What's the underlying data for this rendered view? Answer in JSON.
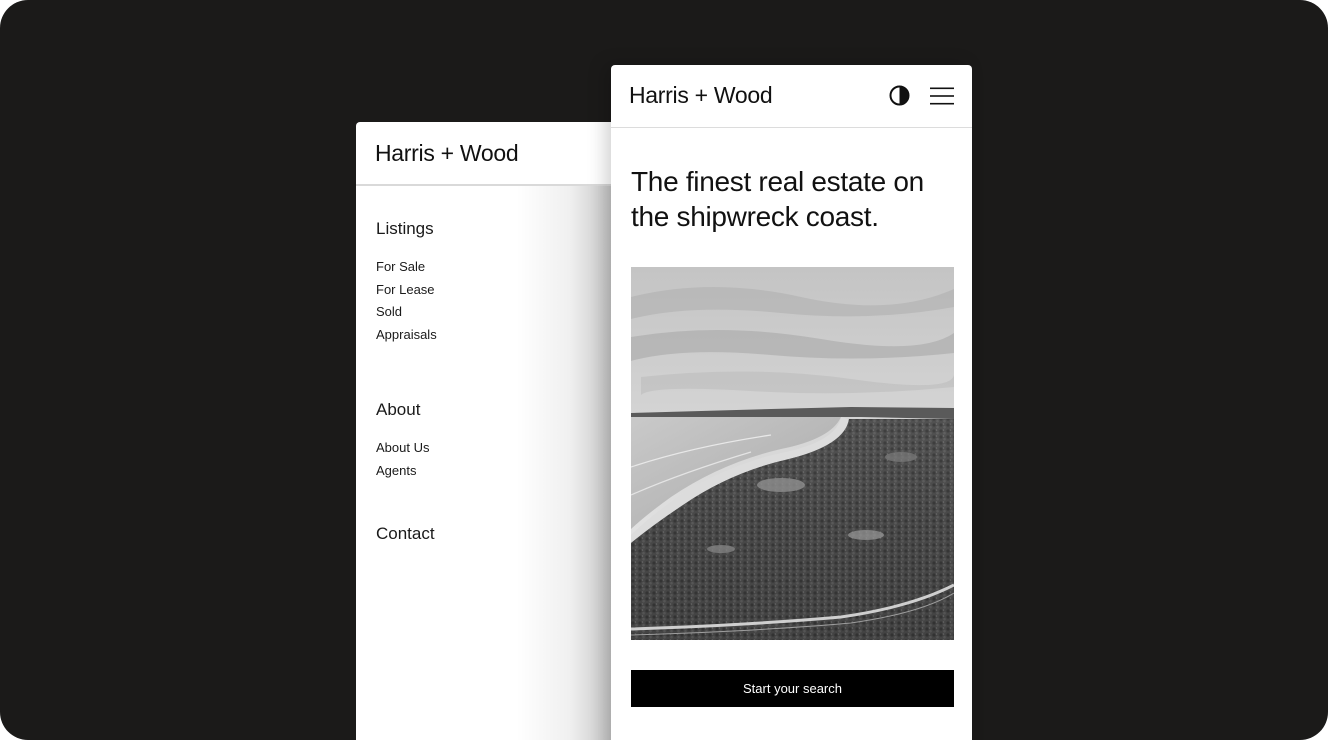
{
  "brand": "Harris + Wood",
  "menu": {
    "sections": [
      {
        "title": "Listings",
        "items": [
          "For Sale",
          "For Lease",
          "Sold",
          "Appraisals"
        ]
      },
      {
        "title": "About",
        "items": [
          "About Us",
          "Agents"
        ]
      },
      {
        "title": "Contact",
        "items": []
      }
    ]
  },
  "home": {
    "headline": "The finest real estate on the shipwreck coast.",
    "cta_label": "Start your search",
    "icons": {
      "theme_toggle": "contrast-icon",
      "menu": "hamburger-icon"
    },
    "hero_image_alt": "Aerial black and white view of a coastline with a curved beach and bushland"
  },
  "colors": {
    "background": "#1b1a19",
    "panel": "#ffffff",
    "text": "#111111",
    "button": "#000000",
    "button_text": "#ffffff"
  }
}
